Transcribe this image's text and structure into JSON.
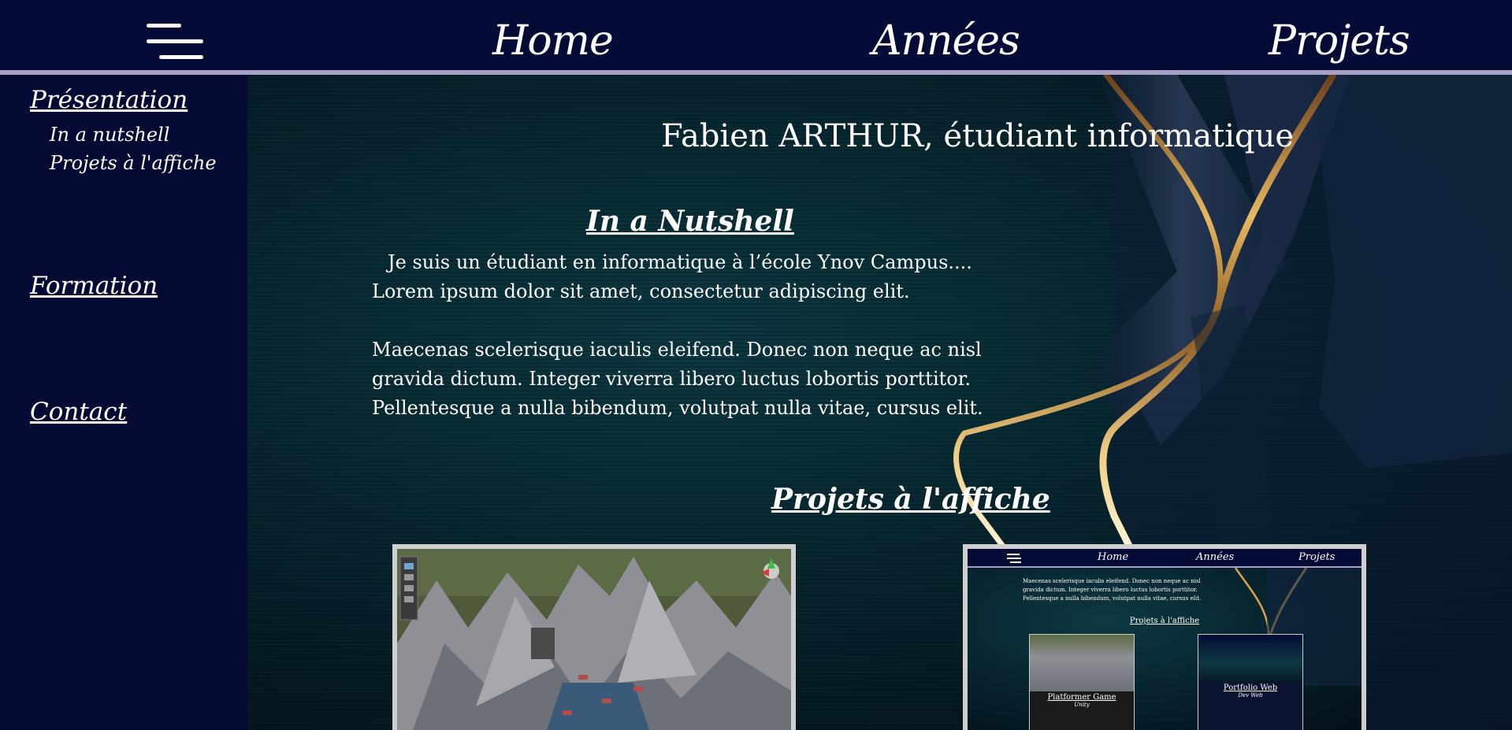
{
  "nav": {
    "menu_icon": "hamburger-menu-icon",
    "links": [
      "Home",
      "Années",
      "Projets"
    ]
  },
  "sidebar": {
    "presentation": "Présentation",
    "sub_items": [
      "In a nutshell",
      "Projets à l'affiche"
    ],
    "formation": "Formation",
    "contact": "Contact"
  },
  "main": {
    "title": "Fabien ARTHUR, étudiant informatique",
    "nutshell_heading": "In a Nutshell",
    "nutshell_lines": [
      "Je suis un étudiant en informatique à l’école Ynov Campus....",
      "Lorem ipsum dolor sit amet, consectetur adipiscing elit.",
      "Maecenas scelerisque iaculis eleifend. Donec non neque ac nisl",
      "gravida dictum. Integer viverra libero luctus lobortis porttitor.",
      "Pellentesque a nulla bibendum, volutpat nulla vitae, cursus elit."
    ],
    "projets_heading": "Projets à l'affiche"
  },
  "thumb": {
    "nav": [
      "Home",
      "Années",
      "Projets"
    ],
    "lines": [
      "Maecenas scelerisque iaculis eleifend. Donec non neque ac nisl",
      "gravida dictum. Integer viverra libero luctus lobortis porttitor.",
      "Pellentesque a nulla bibendum, volutpat nulla vitae, cursus elit."
    ],
    "heading": "Projets à l'affiche",
    "card1_title": "Platformer Game",
    "card1_sub": "Unity",
    "card2_title": "Portfolio Web",
    "card2_sub": "Dev Web"
  },
  "colors": {
    "nav_bg": "#040b36",
    "nav_line": "#a79fc4",
    "sidebar_bg": "#050a35",
    "gold": "#d8a451"
  }
}
